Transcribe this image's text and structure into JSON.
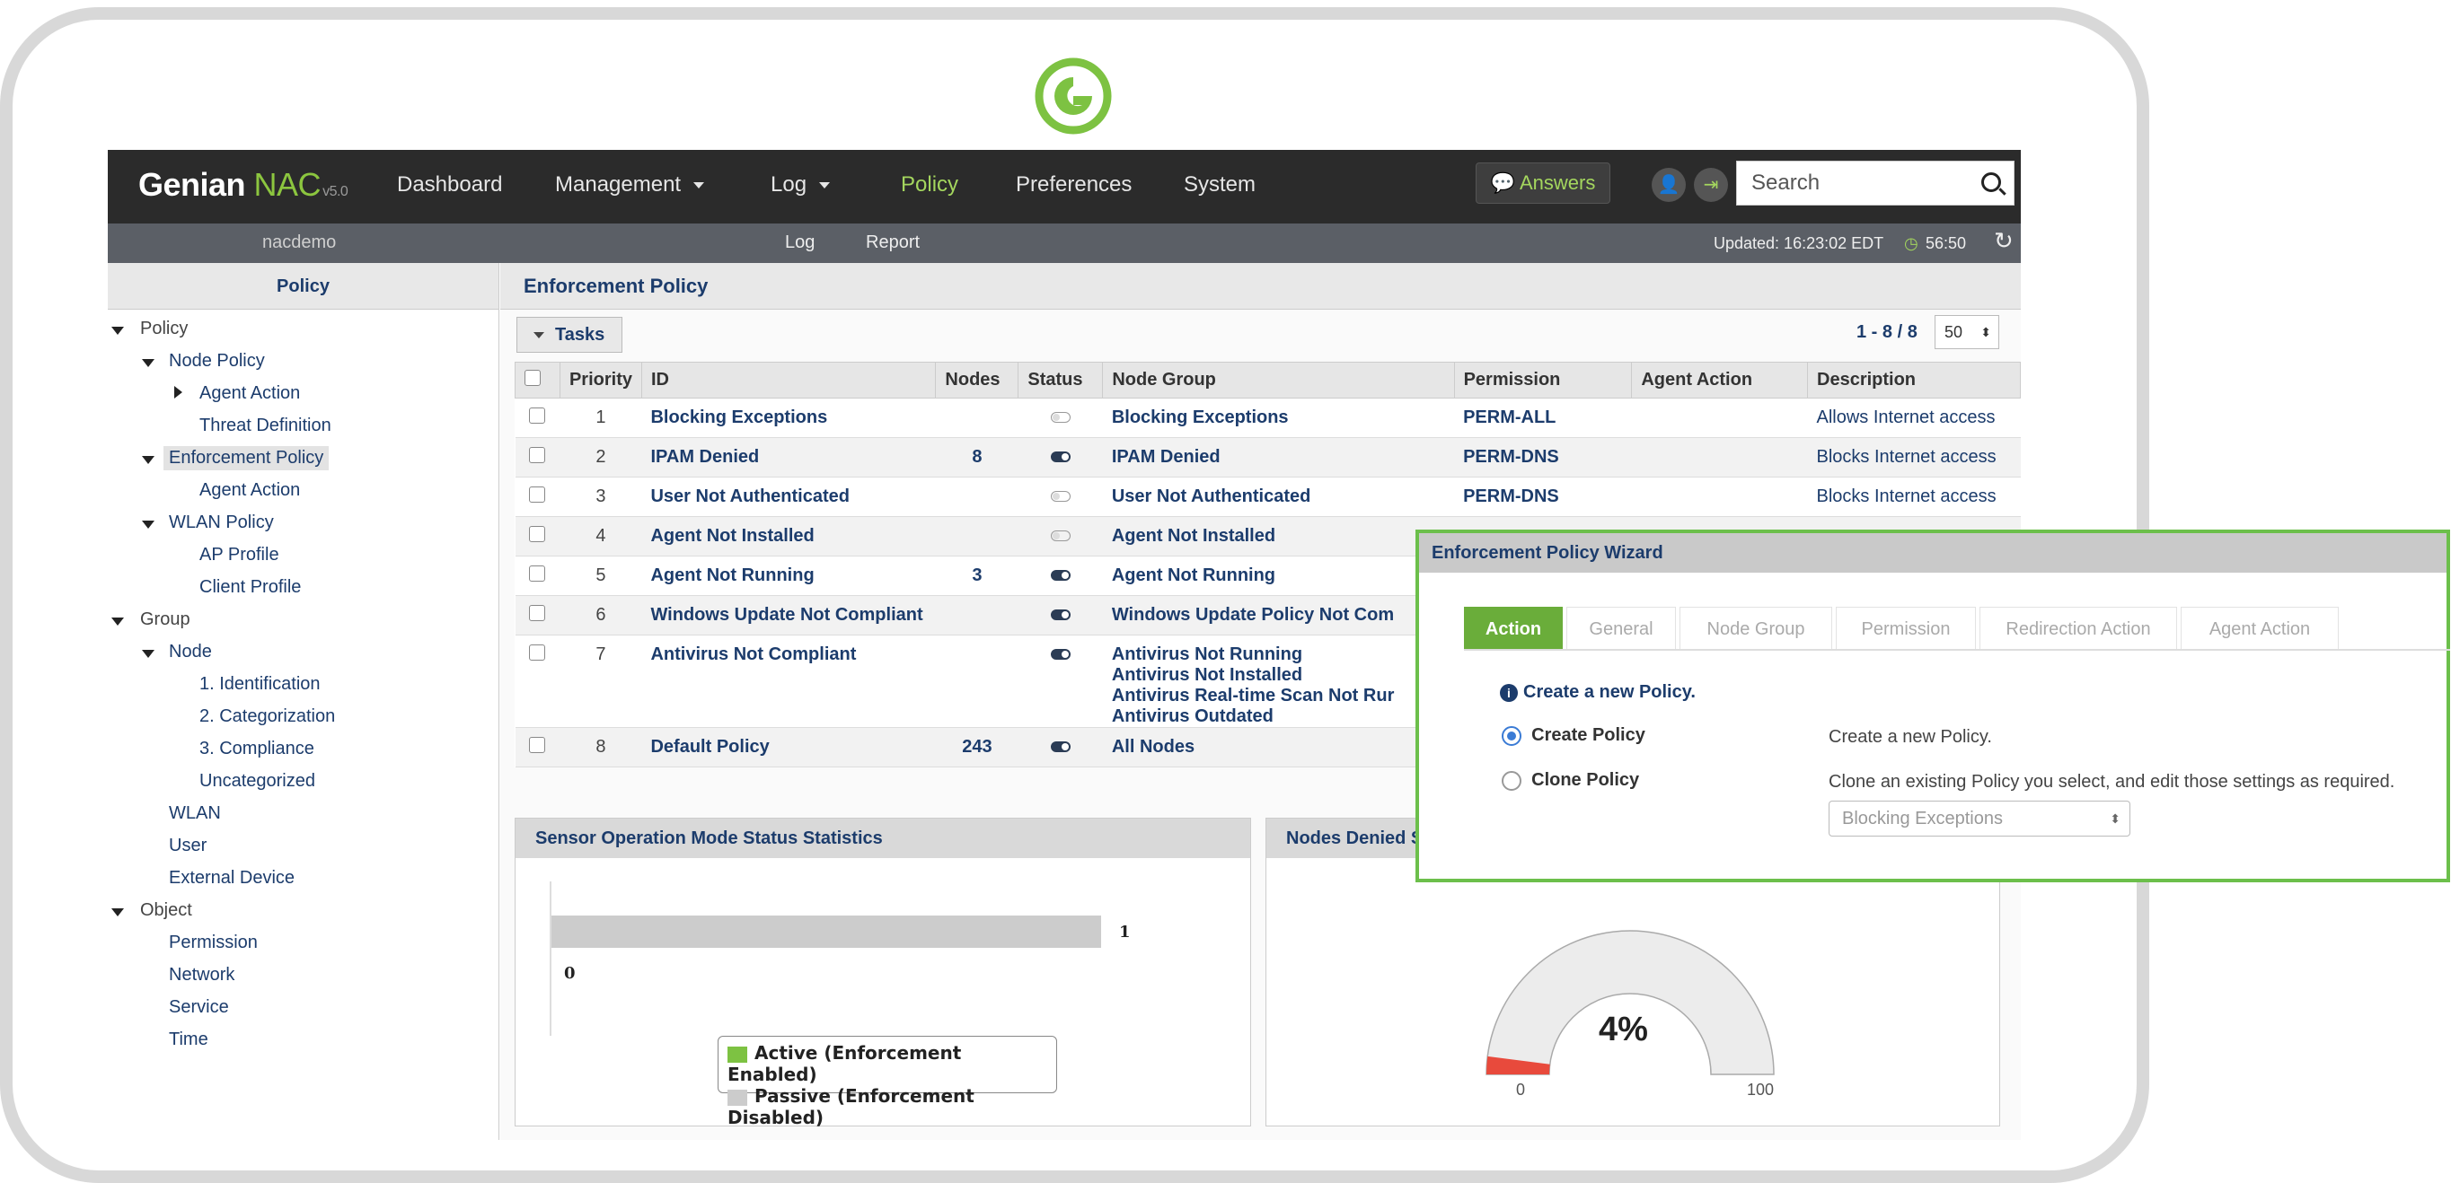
{
  "brand": {
    "name": "Genian",
    "product": "NAC",
    "version": "v5.0"
  },
  "nav": {
    "dashboard": "Dashboard",
    "management": "Management",
    "log": "Log",
    "policy": "Policy",
    "preferences": "Preferences",
    "system": "System",
    "answers": "Answers"
  },
  "search": {
    "placeholder": "Search"
  },
  "subbar": {
    "user": "nacdemo",
    "log": "Log",
    "report": "Report",
    "updated": "Updated: 16:23:02 EDT",
    "timer": "56:50"
  },
  "tree": {
    "header": "Policy",
    "items": [
      "Policy",
      "Node Policy",
      "Agent Action",
      "Threat Definition",
      "Enforcement Policy",
      "Agent Action",
      "WLAN Policy",
      "AP Profile",
      "Client Profile",
      "Group",
      "Node",
      "1. Identification",
      "2. Categorization",
      "3. Compliance",
      "Uncategorized",
      "WLAN",
      "User",
      "External Device",
      "Object",
      "Permission",
      "Network",
      "Service",
      "Time"
    ]
  },
  "main": {
    "title": "Enforcement Policy",
    "tasks": "Tasks",
    "pager": "1 - 8 / 8",
    "page_size": "50"
  },
  "table": {
    "headers": [
      "Priority",
      "ID",
      "Nodes",
      "Status",
      "Node Group",
      "Permission",
      "Agent Action",
      "Description"
    ],
    "rows": [
      {
        "priority": "1",
        "id": "Blocking Exceptions",
        "nodes": "",
        "status": "off",
        "group": "Blocking Exceptions",
        "permission": "PERM-ALL",
        "desc": "Allows Internet access"
      },
      {
        "priority": "2",
        "id": "IPAM Denied",
        "nodes": "8",
        "status": "on",
        "group": "IPAM Denied",
        "permission": "PERM-DNS",
        "desc": "Blocks Internet access"
      },
      {
        "priority": "3",
        "id": "User Not Authenticated",
        "nodes": "",
        "status": "off",
        "group": "User Not Authenticated",
        "permission": "PERM-DNS",
        "desc": "Blocks Internet access"
      },
      {
        "priority": "4",
        "id": "Agent Not Installed",
        "nodes": "",
        "status": "off",
        "group": "Agent Not Installed",
        "permission": "",
        "desc": ""
      },
      {
        "priority": "5",
        "id": "Agent Not Running",
        "nodes": "3",
        "status": "on",
        "group": "Agent Not Running",
        "permission": "",
        "desc": ""
      },
      {
        "priority": "6",
        "id": "Windows Update Not Compliant",
        "nodes": "",
        "status": "on",
        "group": "Windows Update Policy Not Com",
        "permission": "",
        "desc": ""
      },
      {
        "priority": "7",
        "id": "Antivirus Not Compliant",
        "nodes": "",
        "status": "on",
        "group": "Antivirus Not Running",
        "group2": "Antivirus Not Installed",
        "group3": "Antivirus Real-time Scan Not Rur",
        "group4": "Antivirus Outdated",
        "permission": "",
        "desc": ""
      },
      {
        "priority": "8",
        "id": "Default Policy",
        "nodes": "243",
        "status": "on",
        "group": "All Nodes",
        "permission": "",
        "desc": ""
      }
    ]
  },
  "sensor_panel": {
    "title": "Sensor Operation Mode Status Statistics",
    "bar_value": "1",
    "zero": "0",
    "legend_active": "Active (Enforcement Enabled)",
    "legend_passive": "Passive (Enforcement Disabled)",
    "active_color": "#7dc242",
    "passive_color": "#cccccc"
  },
  "denied_panel": {
    "title": "Nodes Denied S",
    "gauge_value": "4%",
    "gauge_fraction": 0.04,
    "gauge_min": "0",
    "gauge_max": "100"
  },
  "wizard": {
    "title": "Enforcement Policy Wizard",
    "tabs": [
      "Action",
      "General",
      "Node Group",
      "Permission",
      "Redirection Action",
      "Agent Action"
    ],
    "intro": "Create a new Policy.",
    "option1_label": "Create Policy",
    "option1_desc": "Create a new Policy.",
    "option2_label": "Clone Policy",
    "option2_desc": "Clone an existing Policy you select, and edit those settings as required.",
    "clone_select": "Blocking Exceptions"
  }
}
